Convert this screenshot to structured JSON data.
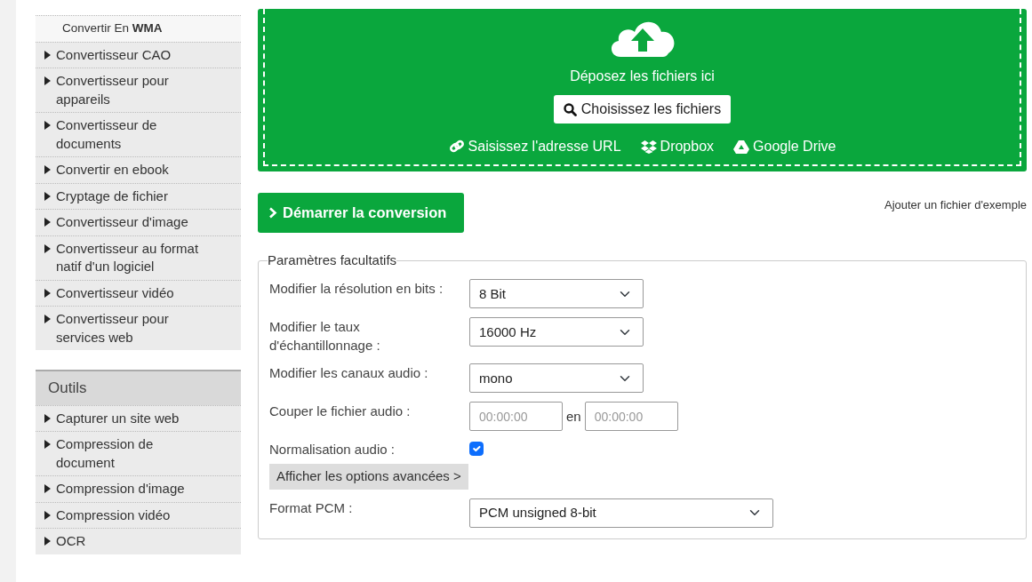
{
  "sidebar": {
    "items": [
      {
        "label": "Convertir En **WMA**",
        "kind": "sub",
        "selected": true
      },
      {
        "label": "Convertisseur CAO",
        "kind": "category",
        "selected": false
      },
      {
        "label": "Convertisseur pour appareils",
        "kind": "category",
        "selected": false
      },
      {
        "label": "Convertisseur de documents",
        "kind": "category",
        "selected": false
      },
      {
        "label": "Convertir en ebook",
        "kind": "category",
        "selected": false
      },
      {
        "label": "Cryptage de fichier",
        "kind": "category",
        "selected": false
      },
      {
        "label": "Convertisseur d'image",
        "kind": "category",
        "selected": false
      },
      {
        "label": "Convertisseur au format natif d'un logiciel",
        "kind": "category",
        "selected": false
      },
      {
        "label": "Convertisseur vidéo",
        "kind": "category",
        "selected": false
      },
      {
        "label": "Convertisseur pour services web",
        "kind": "category",
        "selected": false
      }
    ]
  },
  "tools": {
    "title": "Outils",
    "items": [
      {
        "label": "Capturer un site web",
        "kind": "category",
        "selected": false
      },
      {
        "label": "Compression de document",
        "kind": "category",
        "selected": false
      },
      {
        "label": "Compression d'image",
        "kind": "category",
        "selected": false
      },
      {
        "label": "Compression vidéo",
        "kind": "category",
        "selected": false
      },
      {
        "label": "OCR",
        "kind": "category",
        "selected": false
      }
    ]
  },
  "upload": {
    "drop_text": "Déposez les fichiers ici",
    "choose_button": "Choisissez les fichiers",
    "sources": [
      {
        "label": "Saisissez l'adresse URL",
        "kind": "url"
      },
      {
        "label": "Dropbox",
        "kind": "dropbox"
      },
      {
        "label": "Google Drive",
        "kind": "drive"
      }
    ]
  },
  "start_button": "Démarrer la conversion",
  "example_link": "Ajouter un fichier d'exemple",
  "options": {
    "legend": "Paramètres facultatifs",
    "fields": [
      {
        "label": "Modifier la résolution en bits :",
        "kind": "select",
        "value": "8 Bit"
      },
      {
        "label": "Modifier le taux d'échantillonnage :",
        "kind": "select",
        "value": "16000 Hz"
      },
      {
        "label": "Modifier les canaux audio :",
        "kind": "select",
        "value": "mono"
      },
      {
        "label": "Couper le fichier audio :",
        "kind": "range",
        "from_placeholder": "00:00:00",
        "separator": "en",
        "to_placeholder": "00:00:00"
      },
      {
        "label": "Normalisation audio :",
        "kind": "checkbox",
        "checked": true
      }
    ],
    "advanced_button": "Afficher les options avancées >",
    "pcm": {
      "label": "Format PCM :",
      "value": "PCM unsigned 8-bit"
    }
  }
}
